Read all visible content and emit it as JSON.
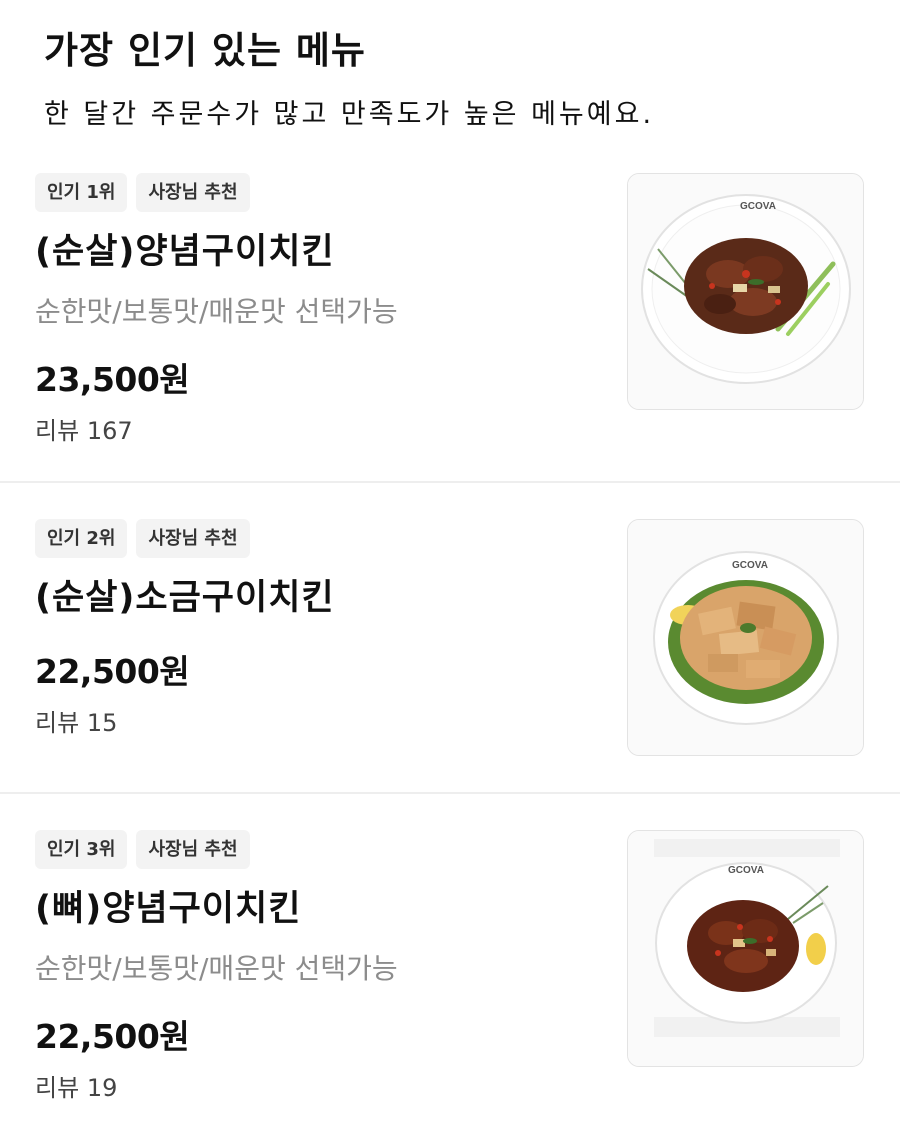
{
  "header": {
    "title": "가장 인기 있는 메뉴",
    "subtitle": "한 달간 주문수가 많고 만족도가 높은 메뉴예요."
  },
  "items": [
    {
      "rank_tag": "인기 1위",
      "owner_tag": "사장님 추천",
      "name": "(순살)양념구이치킨",
      "desc": "순한맛/보통맛/매운맛 선택가능",
      "price": "23,500원",
      "review_label": "리뷰",
      "review_count": "167",
      "plate_logo": "GCOVA"
    },
    {
      "rank_tag": "인기 2위",
      "owner_tag": "사장님 추천",
      "name": "(순살)소금구이치킨",
      "desc": "",
      "price": "22,500원",
      "review_label": "리뷰",
      "review_count": "15",
      "plate_logo": "GCOVA"
    },
    {
      "rank_tag": "인기 3위",
      "owner_tag": "사장님 추천",
      "name": "(뼈)양념구이치킨",
      "desc": "순한맛/보통맛/매운맛 선택가능",
      "price": "22,500원",
      "review_label": "리뷰",
      "review_count": "19",
      "plate_logo": "GCOVA"
    }
  ]
}
